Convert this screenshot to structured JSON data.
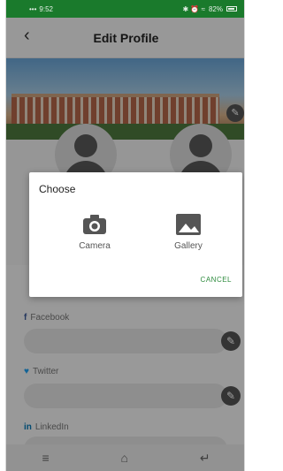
{
  "status_bar": {
    "time": "9:52",
    "signal": "•••",
    "right_icons": "✱ ⏰ ≈",
    "battery": "82%"
  },
  "app_bar": {
    "back_label": "‹",
    "title": "Edit Profile"
  },
  "social": {
    "facebook_icon": "f",
    "facebook_label": "Facebook",
    "twitter_icon": "♥",
    "twitter_label": "Twitter",
    "linkedin_icon": "in",
    "linkedin_label": "LinkedIn"
  },
  "dialog": {
    "title": "Choose",
    "camera_label": "Camera",
    "gallery_label": "Gallery",
    "cancel_label": "CANCEL"
  },
  "nav": {
    "menu_glyph": "≡",
    "home_glyph": "⌂",
    "back_glyph": "↵"
  },
  "colors": {
    "status_bar": "#1a7a2c",
    "accent": "#2e8b3e",
    "icon_dark": "#555555"
  }
}
